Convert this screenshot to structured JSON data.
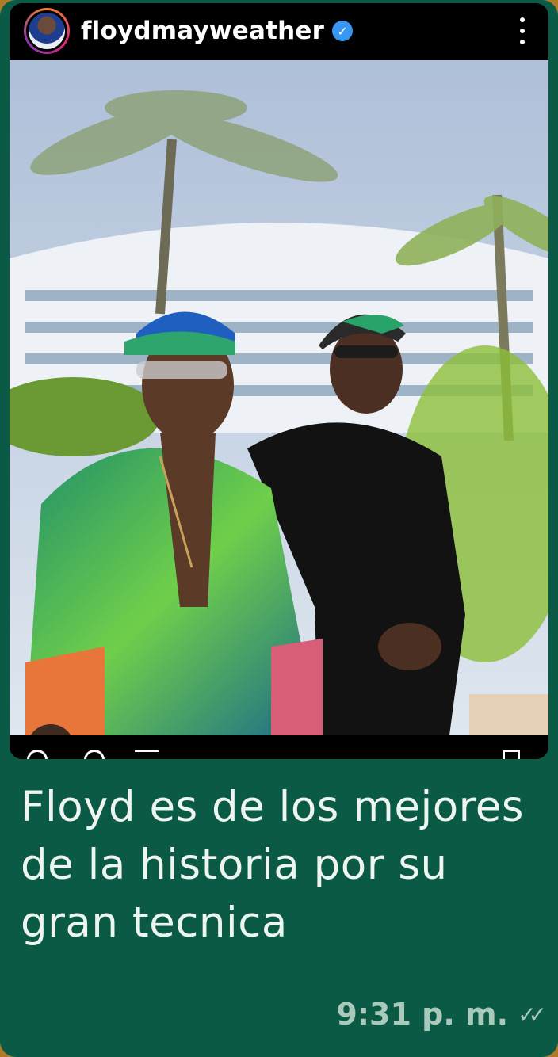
{
  "post": {
    "username": "floydmayweather",
    "verified_icon": "verified-badge-icon",
    "more_icon": "more-vertical-icon",
    "photo_description_icon": "post-photo",
    "tag_icon": "user-tag-icon",
    "actions": [
      "like-icon",
      "comment-icon",
      "share-icon",
      "save-icon"
    ]
  },
  "message": {
    "text": "Floyd es de los mejores de la historia por su gran tecnica",
    "time": "9:31 p. m.",
    "status_icon": "double-check-icon"
  },
  "colors": {
    "bubble": "#0b5a45",
    "text": "#eef5f1",
    "meta": "#a9c9bb",
    "verified": "#3897f0"
  }
}
